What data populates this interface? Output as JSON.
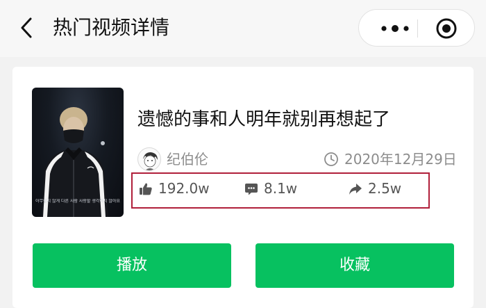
{
  "nav": {
    "title": "热门视频详情",
    "more_icon": "more-dots-icon",
    "close_icon": "target-circle-icon"
  },
  "video": {
    "title": "遗憾的事和人明年就别再想起了",
    "author": "纪伯伦",
    "date": "2020年12月29日",
    "thumbnail_caption": "아무렇지 않게 다른 사람 사랑할 생각하지 않아요"
  },
  "stats": {
    "likes": "192.0w",
    "comments": "8.1w",
    "shares": "2.5w"
  },
  "buttons": {
    "play": "播放",
    "favorite": "收藏"
  },
  "colors": {
    "primary": "#07c160",
    "highlight_border": "#b01f3a",
    "muted_text": "#8c8c8c"
  }
}
